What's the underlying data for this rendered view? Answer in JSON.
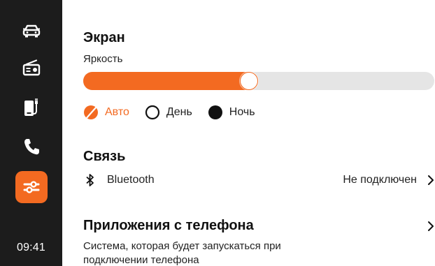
{
  "sidebar": {
    "items": [
      {
        "name": "car",
        "icon": "car-icon"
      },
      {
        "name": "radio",
        "icon": "radio-icon"
      },
      {
        "name": "phone-charging",
        "icon": "phone-charging-icon"
      },
      {
        "name": "phone-call",
        "icon": "phone-icon"
      },
      {
        "name": "settings",
        "icon": "settings-sliders-icon",
        "active": true
      }
    ],
    "time": "09:41"
  },
  "colors": {
    "accent": "#f36a21",
    "sidebar_bg": "#1c1c1c",
    "track": "#e5e5e5"
  },
  "screen": {
    "title": "Экран",
    "brightness_label": "Яркость",
    "brightness_level": 0.47,
    "modes": [
      {
        "label": "Авто",
        "selected": true
      },
      {
        "label": "День",
        "selected": false
      },
      {
        "label": "Ночь",
        "selected": false
      }
    ]
  },
  "connection": {
    "title": "Связь",
    "bluetooth_label": "Bluetooth",
    "bluetooth_status": "Не подключен"
  },
  "apps": {
    "title": "Приложения с телефона",
    "description": "Система, которая будет запускаться при подключении телефона"
  }
}
